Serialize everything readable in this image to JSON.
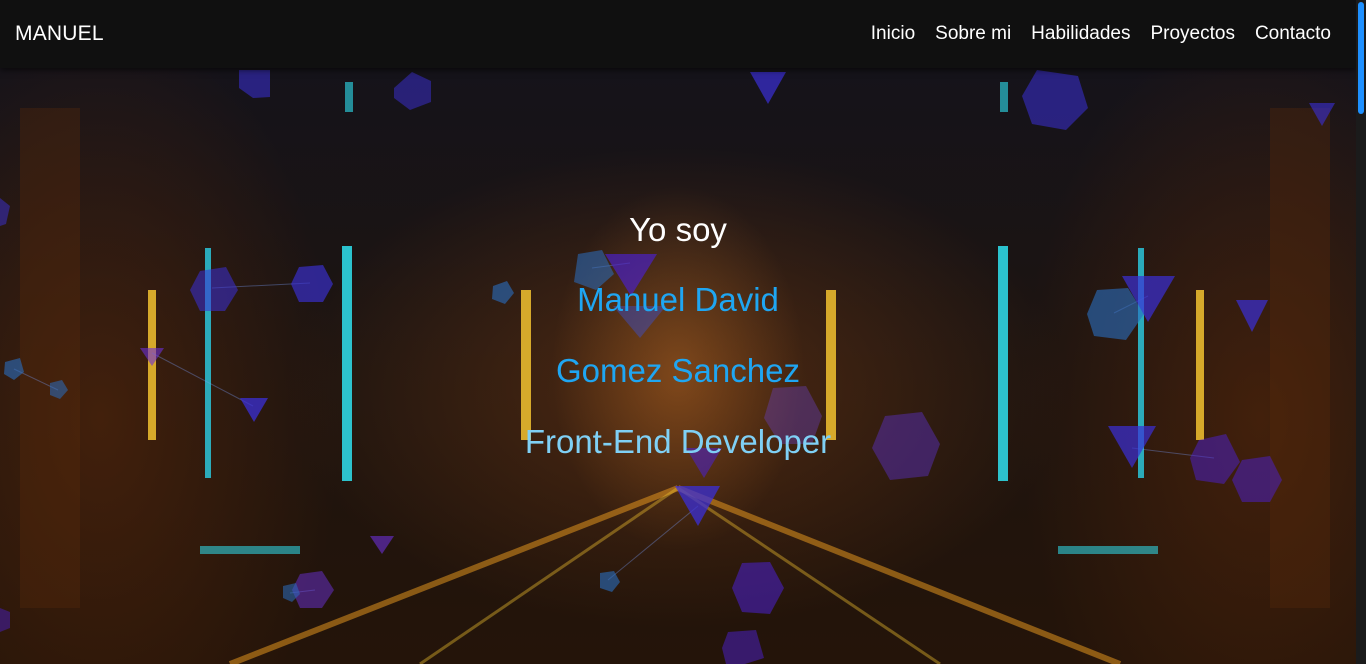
{
  "nav": {
    "brand": "MANUEL",
    "links": [
      "Inicio",
      "Sobre mi",
      "Habilidades",
      "Proyectos",
      "Contacto"
    ]
  },
  "hero": {
    "greeting": "Yo soy",
    "lines": [
      "Manuel David",
      "Gomez Sanchez",
      "Front-End Developer"
    ]
  },
  "colors": {
    "navbar_bg": "#101010",
    "accent": "#1fa6f2",
    "accent_light": "#7fd0f5",
    "particle": "#3b2fd6"
  }
}
